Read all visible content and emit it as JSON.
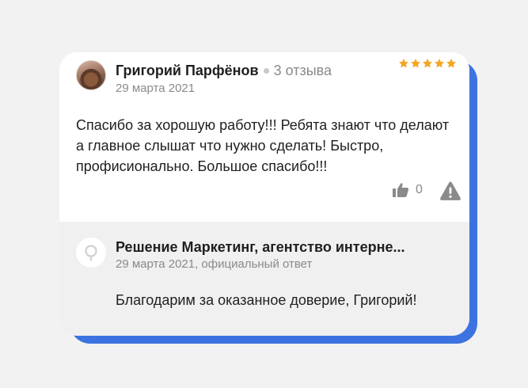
{
  "review": {
    "author": "Григорий Парфёнов",
    "review_count": "3 отзыва",
    "date": "29 марта 2021",
    "rating": 5,
    "text": "Спасибо за хорошую работу!!! Ребята знают что делают а главное слышат что нужно сделать! Быстро, профисионально. Большое спасибо!!!",
    "likes": "0",
    "icons": {
      "like": "thumbs-up-icon",
      "report": "warning-icon",
      "star": "star-icon"
    },
    "colors": {
      "star": "#f5a623",
      "accent_shadow": "#3c73e0"
    }
  },
  "reply": {
    "company": "Решение Маркетинг, агентство интерне...",
    "meta": "29 марта 2021, официальный ответ",
    "text": "Благодарим за оказанное доверие, Григорий!"
  }
}
